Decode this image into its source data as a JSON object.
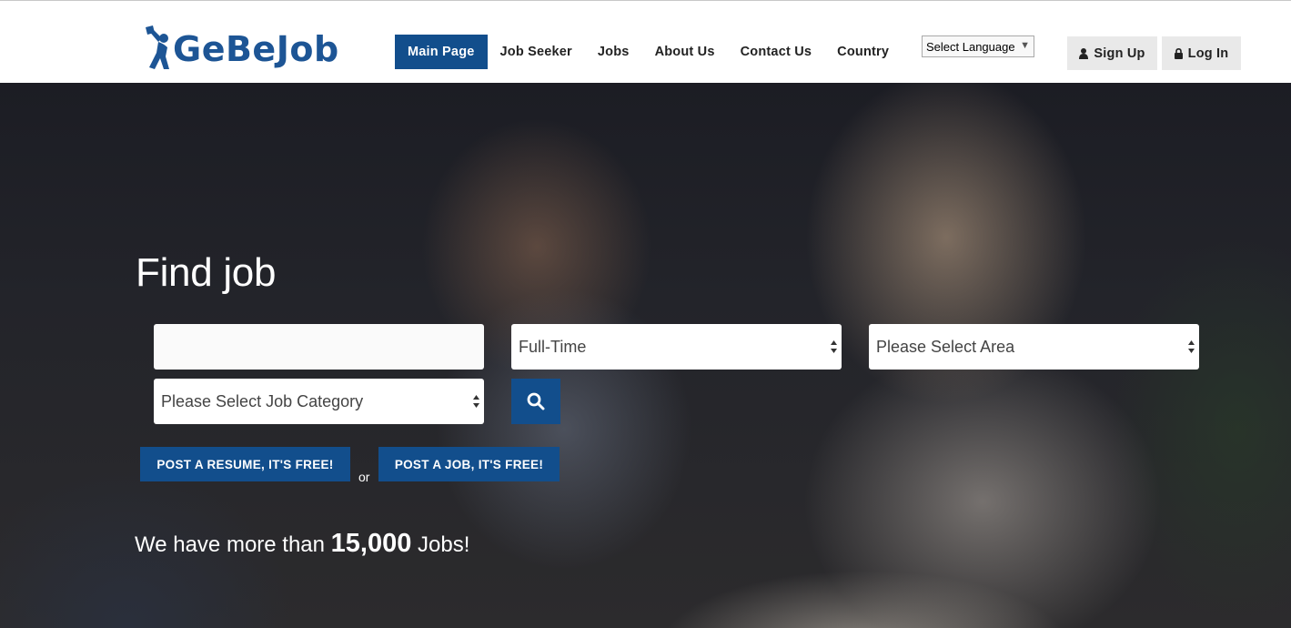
{
  "logo": {
    "text": "GeBeJob"
  },
  "nav": {
    "items": [
      {
        "label": "Main Page",
        "active": true
      },
      {
        "label": "Job Seeker",
        "active": false
      },
      {
        "label": "Jobs",
        "active": false
      },
      {
        "label": "About Us",
        "active": false
      },
      {
        "label": "Contact Us",
        "active": false
      },
      {
        "label": "Country",
        "active": false
      }
    ],
    "language_select": {
      "value": "Select Language",
      "icon": "triangle-down-icon"
    }
  },
  "auth": {
    "signup_label": "Sign Up",
    "signup_icon": "user-icon",
    "login_label": "Log In",
    "login_icon": "lock-icon"
  },
  "hero": {
    "title": "Find job",
    "search": {
      "keyword_value": "",
      "job_type_value": "Full-Time",
      "area_value": "Please Select Area",
      "category_value": "Please Select Job Category",
      "search_icon": "search-icon"
    },
    "cta": {
      "post_resume_label": "POST A RESUME, IT'S FREE!",
      "or_label": "or",
      "post_job_label": "POST A JOB, IT'S FREE!"
    },
    "tagline": {
      "prefix": "We have more than ",
      "count": "15,000",
      "suffix": " Jobs!"
    }
  },
  "colors": {
    "brand": "#1d5595",
    "primary_button": "#124e8c",
    "auth_button_bg": "#e9e9e9"
  }
}
